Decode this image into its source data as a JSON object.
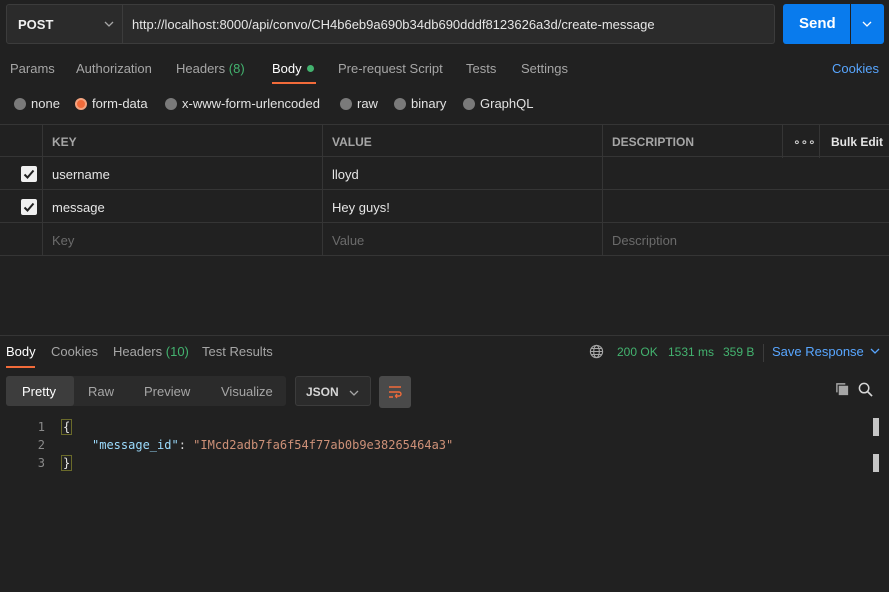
{
  "request": {
    "method": "POST",
    "url": "http://localhost:8000/api/convo/CH4b6eb9a690b34db690dddf8123626a3d/create-message",
    "send_label": "Send"
  },
  "request_tabs": {
    "params": "Params",
    "authorization": "Authorization",
    "headers": "Headers",
    "headers_count": "(8)",
    "body": "Body",
    "pre_request": "Pre-request Script",
    "tests": "Tests",
    "settings": "Settings",
    "cookies": "Cookies"
  },
  "body_types": {
    "none": "none",
    "form_data": "form-data",
    "urlencoded": "x-www-form-urlencoded",
    "raw": "raw",
    "binary": "binary",
    "graphql": "GraphQL",
    "selected": "form-data"
  },
  "kv_table": {
    "headers": {
      "key": "KEY",
      "value": "VALUE",
      "description": "DESCRIPTION",
      "more": "∘∘∘",
      "bulk_edit": "Bulk Edit"
    },
    "rows": [
      {
        "checked": true,
        "key": "username",
        "value": "lloyd",
        "description": ""
      },
      {
        "checked": true,
        "key": "message",
        "value": "Hey guys!",
        "description": ""
      }
    ],
    "placeholders": {
      "key": "Key",
      "value": "Value",
      "description": "Description"
    }
  },
  "response_tabs": {
    "body": "Body",
    "cookies": "Cookies",
    "headers": "Headers",
    "headers_count": "(10)",
    "test_results": "Test Results",
    "status": "200 OK",
    "time": "1531 ms",
    "size": "359 B",
    "save_response": "Save Response"
  },
  "view_modes": {
    "pretty": "Pretty",
    "raw": "Raw",
    "preview": "Preview",
    "visualize": "Visualize",
    "format": "JSON"
  },
  "code": {
    "lines": [
      "1",
      "2",
      "3"
    ],
    "open_brace": "{",
    "key": "\"message_id\"",
    "colon": ": ",
    "value": "\"IMcd2adb7fa6f54f77ab0b9e38265464a3\"",
    "close_brace": "}"
  },
  "colors": {
    "accent_orange": "#f26b3a",
    "send_blue": "#097bed",
    "status_green": "#43b36f",
    "link_blue": "#58a6ff"
  }
}
